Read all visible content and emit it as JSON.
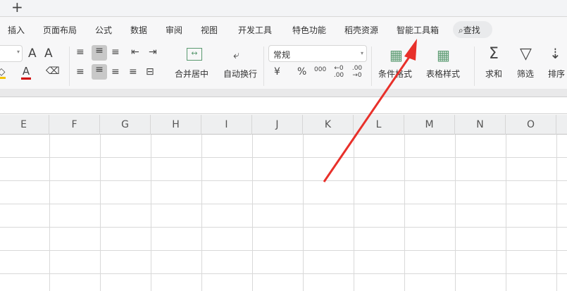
{
  "topbar": {
    "new_tab_icon": "+"
  },
  "tabs": [
    "插入",
    "页面布局",
    "公式",
    "数据",
    "审阅",
    "视图",
    "开发工具",
    "特色功能",
    "稻壳资源",
    "智能工具箱"
  ],
  "search": {
    "label": "查找"
  },
  "ribbon": {
    "font": {
      "grow": "A",
      "shrink": "A",
      "font_color": "A"
    },
    "merge_label": "合并居中",
    "wrap_label": "自动换行",
    "number_format": "常规",
    "currency": "¥",
    "percent": "%",
    "thousands": "000",
    "inc_decimal": "←0 .00",
    "dec_decimal": ".00 →0",
    "cond_format_label": "条件格式",
    "table_style_label": "表格样式",
    "sum_label": "求和",
    "filter_label": "筛选",
    "sort_label": "排序"
  },
  "columns": [
    "E",
    "F",
    "G",
    "H",
    "I",
    "J",
    "K",
    "L",
    "M",
    "N",
    "O"
  ],
  "annotation": {
    "arrow_color": "#e8302a"
  }
}
